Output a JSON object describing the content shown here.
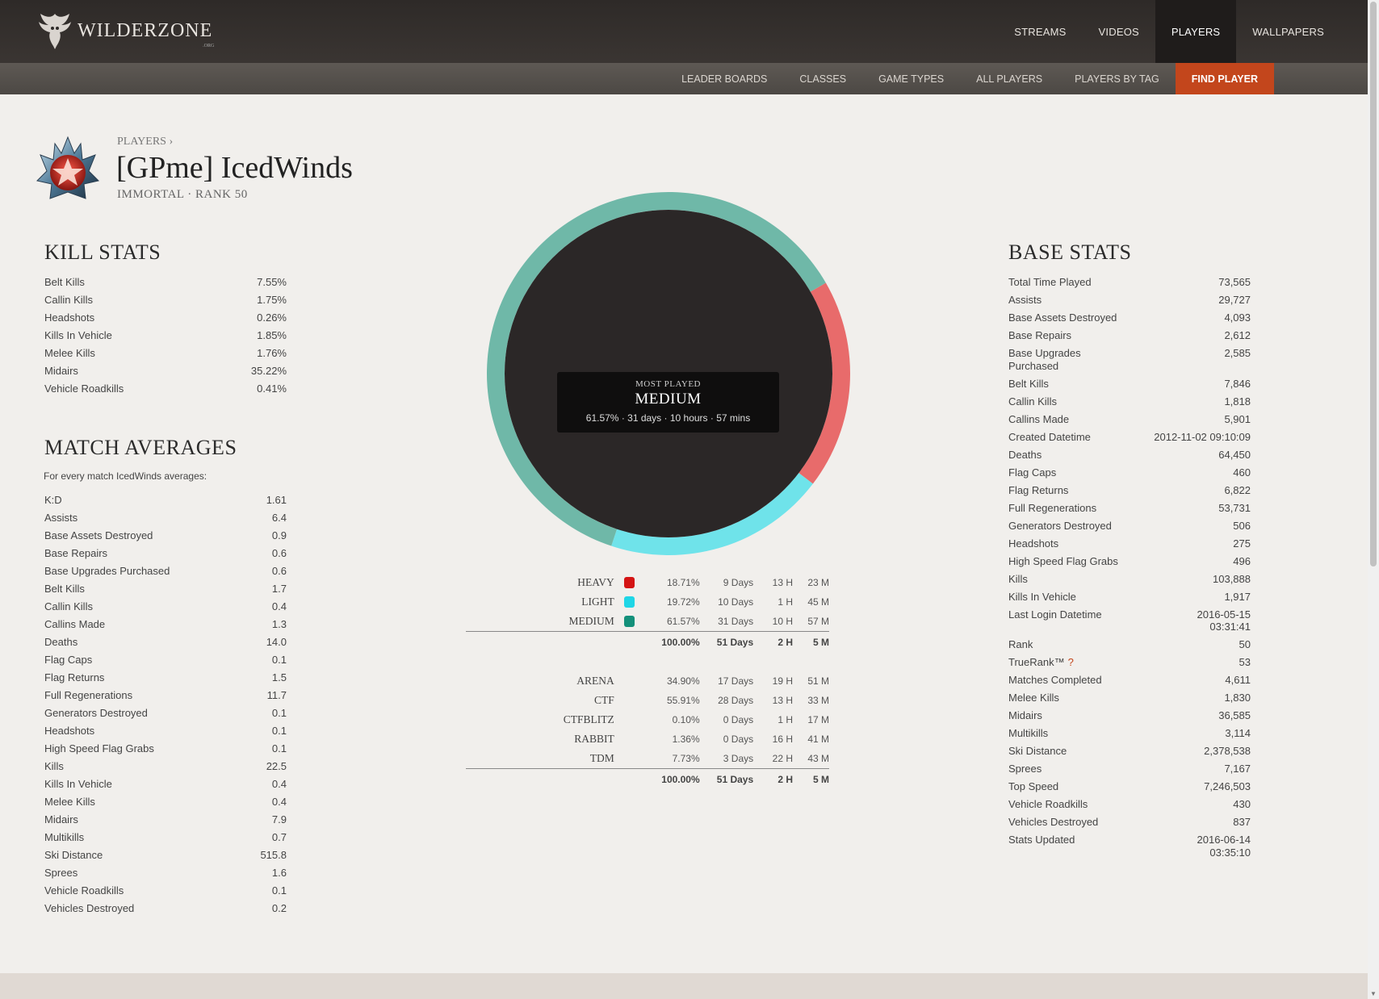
{
  "site": {
    "logo_text": "WILDERZONE",
    "logo_suffix": ".ORG"
  },
  "main_nav": [
    {
      "label": "STREAMS",
      "active": false
    },
    {
      "label": "VIDEOS",
      "active": false
    },
    {
      "label": "PLAYERS",
      "active": true
    },
    {
      "label": "WALLPAPERS",
      "active": false
    }
  ],
  "sub_nav": [
    {
      "label": "LEADER BOARDS",
      "active": false
    },
    {
      "label": "CLASSES",
      "active": false
    },
    {
      "label": "GAME TYPES",
      "active": false
    },
    {
      "label": "ALL PLAYERS",
      "active": false
    },
    {
      "label": "PLAYERS BY TAG",
      "active": false
    },
    {
      "label": "FIND PLAYER",
      "active": true
    }
  ],
  "player": {
    "breadcrumb": "PLAYERS ›",
    "name": "[GPme] IcedWinds",
    "rank_line": "IMMORTAL · RANK 50",
    "badge_icon": "rank-star-badge-icon"
  },
  "kill_stats": {
    "title": "KILL STATS",
    "rows": [
      {
        "label": "Belt Kills",
        "value": "7.55%"
      },
      {
        "label": "Callin Kills",
        "value": "1.75%"
      },
      {
        "label": "Headshots",
        "value": "0.26%"
      },
      {
        "label": "Kills In Vehicle",
        "value": "1.85%"
      },
      {
        "label": "Melee Kills",
        "value": "1.76%"
      },
      {
        "label": "Midairs",
        "value": "35.22%"
      },
      {
        "label": "Vehicle Roadkills",
        "value": "0.41%"
      }
    ]
  },
  "match_averages": {
    "title": "MATCH AVERAGES",
    "subtitle": "For every match IcedWinds averages:",
    "rows": [
      {
        "label": "K:D",
        "value": "1.61"
      },
      {
        "label": "Assists",
        "value": "6.4"
      },
      {
        "label": "Base Assets Destroyed",
        "value": "0.9"
      },
      {
        "label": "Base Repairs",
        "value": "0.6"
      },
      {
        "label": "Base Upgrades Purchased",
        "value": "0.6"
      },
      {
        "label": "Belt Kills",
        "value": "1.7"
      },
      {
        "label": "Callin Kills",
        "value": "0.4"
      },
      {
        "label": "Callins Made",
        "value": "1.3"
      },
      {
        "label": "Deaths",
        "value": "14.0"
      },
      {
        "label": "Flag Caps",
        "value": "0.1"
      },
      {
        "label": "Flag Returns",
        "value": "1.5"
      },
      {
        "label": "Full Regenerations",
        "value": "11.7"
      },
      {
        "label": "Generators Destroyed",
        "value": "0.1"
      },
      {
        "label": "Headshots",
        "value": "0.1"
      },
      {
        "label": "High Speed Flag Grabs",
        "value": "0.1"
      },
      {
        "label": "Kills",
        "value": "22.5"
      },
      {
        "label": "Kills In Vehicle",
        "value": "0.4"
      },
      {
        "label": "Melee Kills",
        "value": "0.4"
      },
      {
        "label": "Midairs",
        "value": "7.9"
      },
      {
        "label": "Multikills",
        "value": "0.7"
      },
      {
        "label": "Ski Distance",
        "value": "515.8"
      },
      {
        "label": "Sprees",
        "value": "1.6"
      },
      {
        "label": "Vehicle Roadkills",
        "value": "0.1"
      },
      {
        "label": "Vehicles Destroyed",
        "value": "0.2"
      }
    ]
  },
  "base_stats": {
    "title": "BASE STATS",
    "rows": [
      {
        "label": "Total Time Played",
        "value": "73,565"
      },
      {
        "label": "Assists",
        "value": "29,727"
      },
      {
        "label": "Base Assets Destroyed",
        "value": "4,093"
      },
      {
        "label": "Base Repairs",
        "value": "2,612"
      },
      {
        "label": "Base Upgrades\nPurchased",
        "value": "2,585"
      },
      {
        "label": "Belt Kills",
        "value": "7,846"
      },
      {
        "label": "Callin Kills",
        "value": "1,818"
      },
      {
        "label": "Callins Made",
        "value": "5,901"
      },
      {
        "label": "Created Datetime",
        "value": "2012-11-02 09:10:09"
      },
      {
        "label": "Deaths",
        "value": "64,450"
      },
      {
        "label": "Flag Caps",
        "value": "460"
      },
      {
        "label": "Flag Returns",
        "value": "6,822"
      },
      {
        "label": "Full Regenerations",
        "value": "53,731"
      },
      {
        "label": "Generators Destroyed",
        "value": "506"
      },
      {
        "label": "Headshots",
        "value": "275"
      },
      {
        "label": "High Speed Flag Grabs",
        "value": "496"
      },
      {
        "label": "Kills",
        "value": "103,888"
      },
      {
        "label": "Kills In Vehicle",
        "value": "1,917"
      },
      {
        "label": "Last Login Datetime",
        "value": "2016-05-15\n03:31:41"
      },
      {
        "label": "Rank",
        "value": "50"
      },
      {
        "label": "TrueRank™",
        "value": "53",
        "help": "?"
      },
      {
        "label": "Matches Completed",
        "value": "4,611"
      },
      {
        "label": "Melee Kills",
        "value": "1,830"
      },
      {
        "label": "Midairs",
        "value": "36,585"
      },
      {
        "label": "Multikills",
        "value": "3,114"
      },
      {
        "label": "Ski Distance",
        "value": "2,378,538"
      },
      {
        "label": "Sprees",
        "value": "7,167"
      },
      {
        "label": "Top Speed",
        "value": "7,246,503"
      },
      {
        "label": "Vehicle Roadkills",
        "value": "430"
      },
      {
        "label": "Vehicles Destroyed",
        "value": "837"
      },
      {
        "label": "Stats Updated",
        "value": "2016-06-14\n03:35:10"
      }
    ]
  },
  "chart_data": {
    "type": "pie",
    "categories": [
      "HEAVY",
      "LIGHT",
      "MEDIUM"
    ],
    "values": [
      18.71,
      19.72,
      61.57
    ],
    "colors": [
      "#e86b6b",
      "#6fe3ea",
      "#6fb8a8"
    ],
    "tooltip": {
      "label": "MOST PLAYED",
      "class": "MEDIUM",
      "detail": "61.57% · 31 days · 10 hours · 57 mins"
    }
  },
  "class_table": {
    "rows": [
      {
        "name": "HEAVY",
        "color": "#d41414",
        "pct": "18.71%",
        "days": "9 Days",
        "hours": "13 H",
        "mins": "23 M"
      },
      {
        "name": "LIGHT",
        "color": "#1fd6e6",
        "pct": "19.72%",
        "days": "10 Days",
        "hours": "1 H",
        "mins": "45 M"
      },
      {
        "name": "MEDIUM",
        "color": "#14907a",
        "pct": "61.57%",
        "days": "31 Days",
        "hours": "10 H",
        "mins": "57 M"
      }
    ],
    "total": {
      "pct": "100.00%",
      "days": "51 Days",
      "hours": "2 H",
      "mins": "5 M"
    }
  },
  "gametype_table": {
    "rows": [
      {
        "name": "ARENA",
        "pct": "34.90%",
        "days": "17 Days",
        "hours": "19 H",
        "mins": "51 M"
      },
      {
        "name": "CTF",
        "pct": "55.91%",
        "days": "28 Days",
        "hours": "13 H",
        "mins": "33 M"
      },
      {
        "name": "CTFBLITZ",
        "pct": "0.10%",
        "days": "0 Days",
        "hours": "1 H",
        "mins": "17 M"
      },
      {
        "name": "RABBIT",
        "pct": "1.36%",
        "days": "0 Days",
        "hours": "16 H",
        "mins": "41 M"
      },
      {
        "name": "TDM",
        "pct": "7.73%",
        "days": "3 Days",
        "hours": "22 H",
        "mins": "43 M"
      }
    ],
    "total": {
      "pct": "100.00%",
      "days": "51 Days",
      "hours": "2 H",
      "mins": "5 M"
    }
  }
}
